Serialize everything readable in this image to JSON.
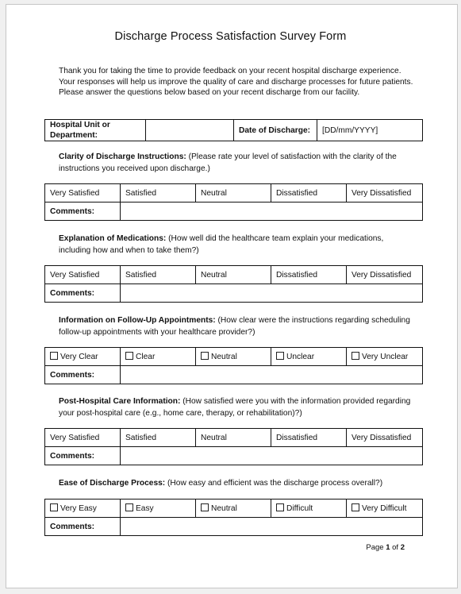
{
  "document": {
    "title": "Discharge Process Satisfaction Survey Form",
    "intro": "Thank you for taking the time to provide feedback on your recent hospital discharge experience. Your responses will help us improve the quality of care and discharge processes for future patients. Please answer the questions below based on your recent discharge from our facility.",
    "header_table": {
      "unit_label": "Hospital Unit or Department:",
      "unit_value": "",
      "date_label": "Date of Discharge:",
      "date_value": "[DD/mm/YYYY]"
    },
    "comments_label": "Comments:",
    "questions": [
      {
        "title": "Clarity of Discharge Instructions:",
        "text": " (Please rate your level of satisfaction with the clarity of the instructions you received upon discharge.)",
        "checkbox": false,
        "options": [
          "Very Satisfied",
          "Satisfied",
          "Neutral",
          "Dissatisfied",
          "Very Dissatisfied"
        ],
        "comments": ""
      },
      {
        "title": "Explanation of Medications:",
        "text": " (How well did the healthcare team explain your medications, including how and when to take them?)",
        "checkbox": false,
        "options": [
          "Very Satisfied",
          "Satisfied",
          "Neutral",
          "Dissatisfied",
          "Very Dissatisfied"
        ],
        "comments": ""
      },
      {
        "title": "Information on Follow-Up Appointments:",
        "text": " (How clear were the instructions regarding scheduling follow-up appointments with your healthcare provider?)",
        "checkbox": true,
        "options": [
          "Very Clear",
          "Clear",
          "Neutral",
          "Unclear",
          "Very Unclear"
        ],
        "comments": ""
      },
      {
        "title": "Post-Hospital Care Information:",
        "text": " (How satisfied were you with the information provided regarding your post-hospital care (e.g., home care, therapy, or rehabilitation)?)",
        "checkbox": false,
        "options": [
          "Very Satisfied",
          "Satisfied",
          "Neutral",
          "Dissatisfied",
          "Very Dissatisfied"
        ],
        "comments": ""
      },
      {
        "title": "Ease of Discharge Process:",
        "text": " (How easy and efficient was the discharge process overall?)",
        "checkbox": true,
        "options": [
          "Very Easy",
          "Easy",
          "Neutral",
          "Difficult",
          "Very Difficult"
        ],
        "comments": ""
      }
    ],
    "footer": {
      "page_word": "Page ",
      "current_page": "1",
      "of_word": " of ",
      "total_pages": "2"
    }
  }
}
